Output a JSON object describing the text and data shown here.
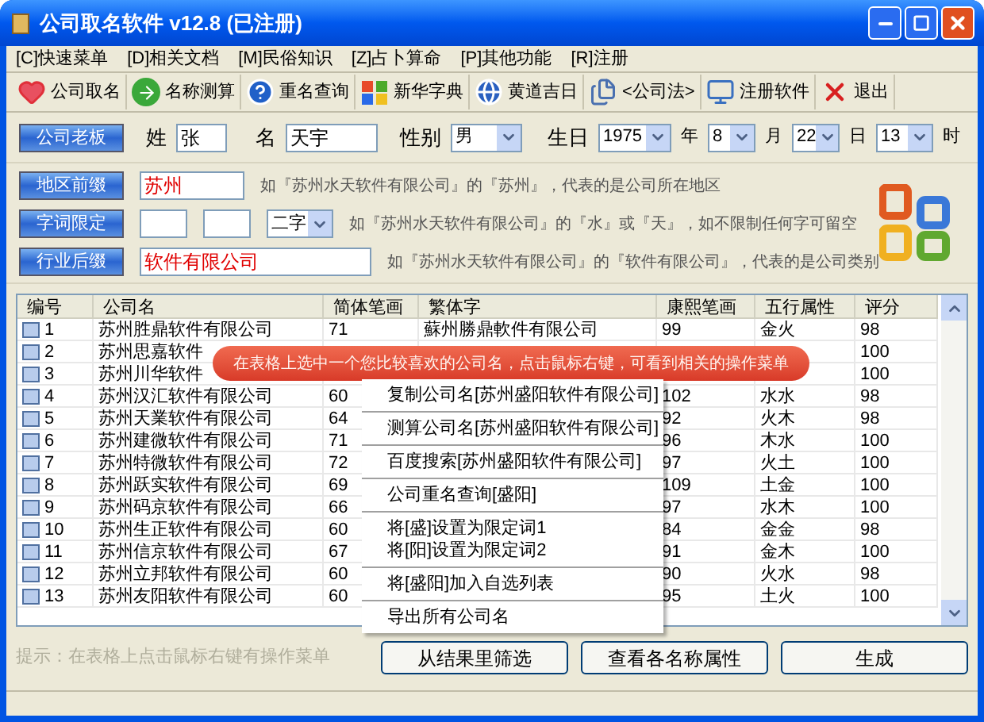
{
  "window": {
    "title": "公司取名软件 v12.8 (已注册)"
  },
  "menu": [
    "[C]快速菜单",
    "[D]相关文档",
    "[M]民俗知识",
    "[Z]占卜算命",
    "[P]其他功能",
    "[R]注册"
  ],
  "toolbar": [
    {
      "kind": "heart",
      "label": "公司取名"
    },
    {
      "kind": "arrow",
      "label": "名称测算"
    },
    {
      "kind": "help",
      "label": "重名查询"
    },
    {
      "kind": "flag",
      "label": "新华字典"
    },
    {
      "kind": "globe",
      "label": "黄道吉日"
    },
    {
      "kind": "docs",
      "label": "<公司法>"
    },
    {
      "kind": "monitor",
      "label": "注册软件"
    },
    {
      "kind": "close",
      "label": "退出"
    }
  ],
  "person": {
    "button": "公司老板",
    "surname_label": "姓",
    "surname": "张",
    "name_label": "名",
    "name": "天宇",
    "gender_label": "性别",
    "gender": "男",
    "birth_label": "生日",
    "year": "1975",
    "year_unit": "年",
    "month": "8",
    "month_unit": "月",
    "day": "22",
    "day_unit": "日",
    "hour": "13",
    "hour_unit": "时"
  },
  "options": [
    {
      "kind": "prefix",
      "button": "地区前缀",
      "value": "苏州",
      "hint": "如『苏州水天软件有限公司』的『苏州』，代表的是公司所在地区"
    },
    {
      "kind": "limit",
      "button": "字词限定",
      "select": "二字",
      "hint": "如『苏州水天软件有限公司』的『水』或『天』，如不限制任何字可留空"
    },
    {
      "kind": "suffix",
      "button": "行业后缀",
      "value": "软件有限公司",
      "hint": "如『苏州水天软件有限公司』的『软件有限公司』，代表的是公司类别"
    }
  ],
  "table": {
    "columns": [
      "编号",
      "公司名",
      "简体笔画",
      "繁体字",
      "康熙笔画",
      "五行属性",
      "评分"
    ],
    "rows": [
      [
        "1",
        "苏州胜鼎软件有限公司",
        "71",
        "蘇州勝鼎軟件有限公司",
        "99",
        "金火",
        "98"
      ],
      [
        "2",
        "苏州思嘉软件",
        "",
        "",
        "",
        "",
        "100"
      ],
      [
        "3",
        "苏州川华软件",
        "",
        "",
        "",
        "",
        "100"
      ],
      [
        "4",
        "苏州汉汇软件有限公司",
        "60",
        "",
        "102",
        "水水",
        "98"
      ],
      [
        "5",
        "苏州天業软件有限公司",
        "64",
        "",
        "92",
        "火木",
        "98"
      ],
      [
        "6",
        "苏州建微软件有限公司",
        "71",
        "",
        "96",
        "木水",
        "100"
      ],
      [
        "7",
        "苏州特微软件有限公司",
        "72",
        "",
        "97",
        "火土",
        "100"
      ],
      [
        "8",
        "苏州跃实软件有限公司",
        "69",
        "",
        "109",
        "土金",
        "100"
      ],
      [
        "9",
        "苏州码京软件有限公司",
        "66",
        "",
        "97",
        "水木",
        "100"
      ],
      [
        "10",
        "苏州生正软件有限公司",
        "60",
        "",
        "84",
        "金金",
        "98"
      ],
      [
        "11",
        "苏州信京软件有限公司",
        "67",
        "",
        "91",
        "金木",
        "100"
      ],
      [
        "12",
        "苏州立邦软件有限公司",
        "60",
        "",
        "90",
        "火水",
        "98"
      ],
      [
        "13",
        "苏州友阳软件有限公司",
        "60",
        "",
        "95",
        "土火",
        "100"
      ]
    ]
  },
  "banner": "在表格上选中一个您比较喜欢的公司名，点击鼠标右键，可看到相关的操作菜单",
  "context_menu": [
    [
      "复制公司名[苏州盛阳软件有限公司]"
    ],
    [
      "测算公司名[苏州盛阳软件有限公司]"
    ],
    [
      "百度搜索[苏州盛阳软件有限公司]"
    ],
    [
      "公司重名查询[盛阳]"
    ],
    [
      "将[盛]设置为限定词1",
      "将[阳]设置为限定词2"
    ],
    [
      "将[盛阳]加入自选列表"
    ],
    [
      "导出所有公司名"
    ]
  ],
  "tip": "提示：在表格上点击鼠标右键有操作菜单",
  "buttons": [
    "从结果里筛选",
    "查看各名称属性",
    "生成"
  ]
}
